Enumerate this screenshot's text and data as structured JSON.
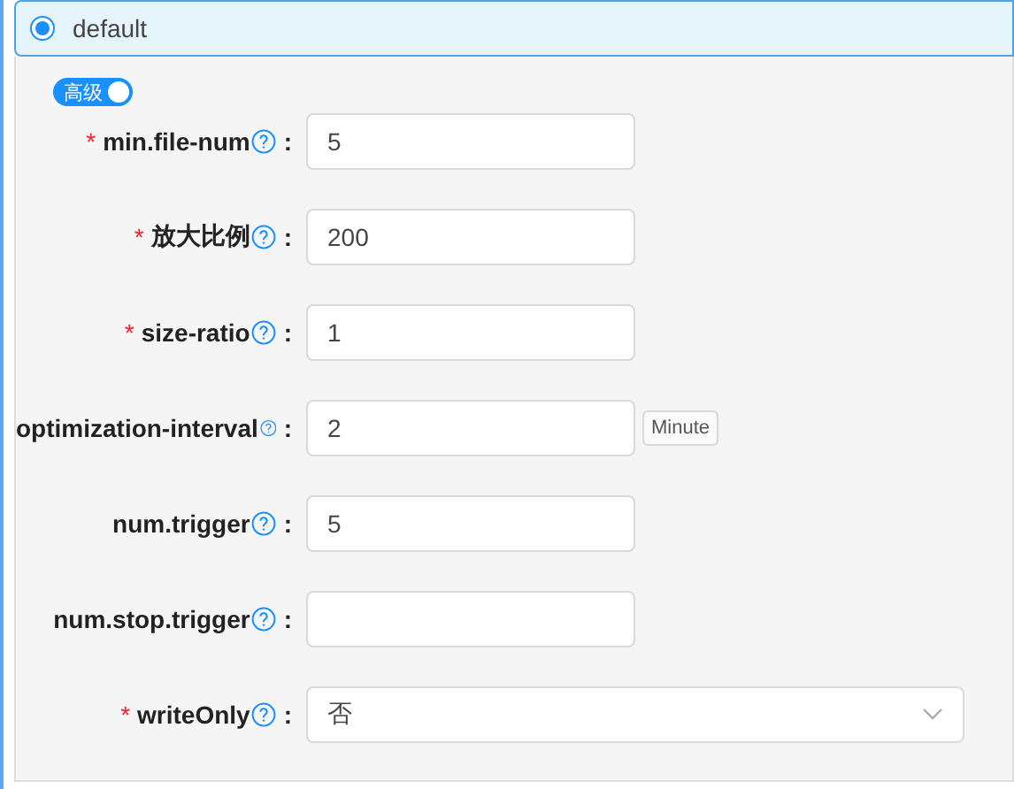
{
  "option": {
    "label": "default",
    "selected": true
  },
  "advanced_toggle": {
    "label": "高级",
    "on": true
  },
  "fields": [
    {
      "kind": "input",
      "required_mark": "*",
      "label": "min.file-num",
      "colon": ":",
      "value": "5"
    },
    {
      "kind": "input",
      "required_mark": "*",
      "label": "放大比例",
      "colon": ":",
      "value": "200"
    },
    {
      "kind": "input",
      "required_mark": "*",
      "label": "size-ratio",
      "colon": ":",
      "value": "1"
    },
    {
      "kind": "input",
      "label": "optimization-interval",
      "colon": ":",
      "value": "2",
      "unit": "Minute"
    },
    {
      "kind": "input",
      "label": "num.trigger",
      "colon": ":",
      "value": "5"
    },
    {
      "kind": "input",
      "label": "num.stop.trigger",
      "colon": ":"
    },
    {
      "kind": "select",
      "required_mark": "*",
      "label": "writeOnly",
      "colon": ":",
      "value": "否"
    }
  ]
}
